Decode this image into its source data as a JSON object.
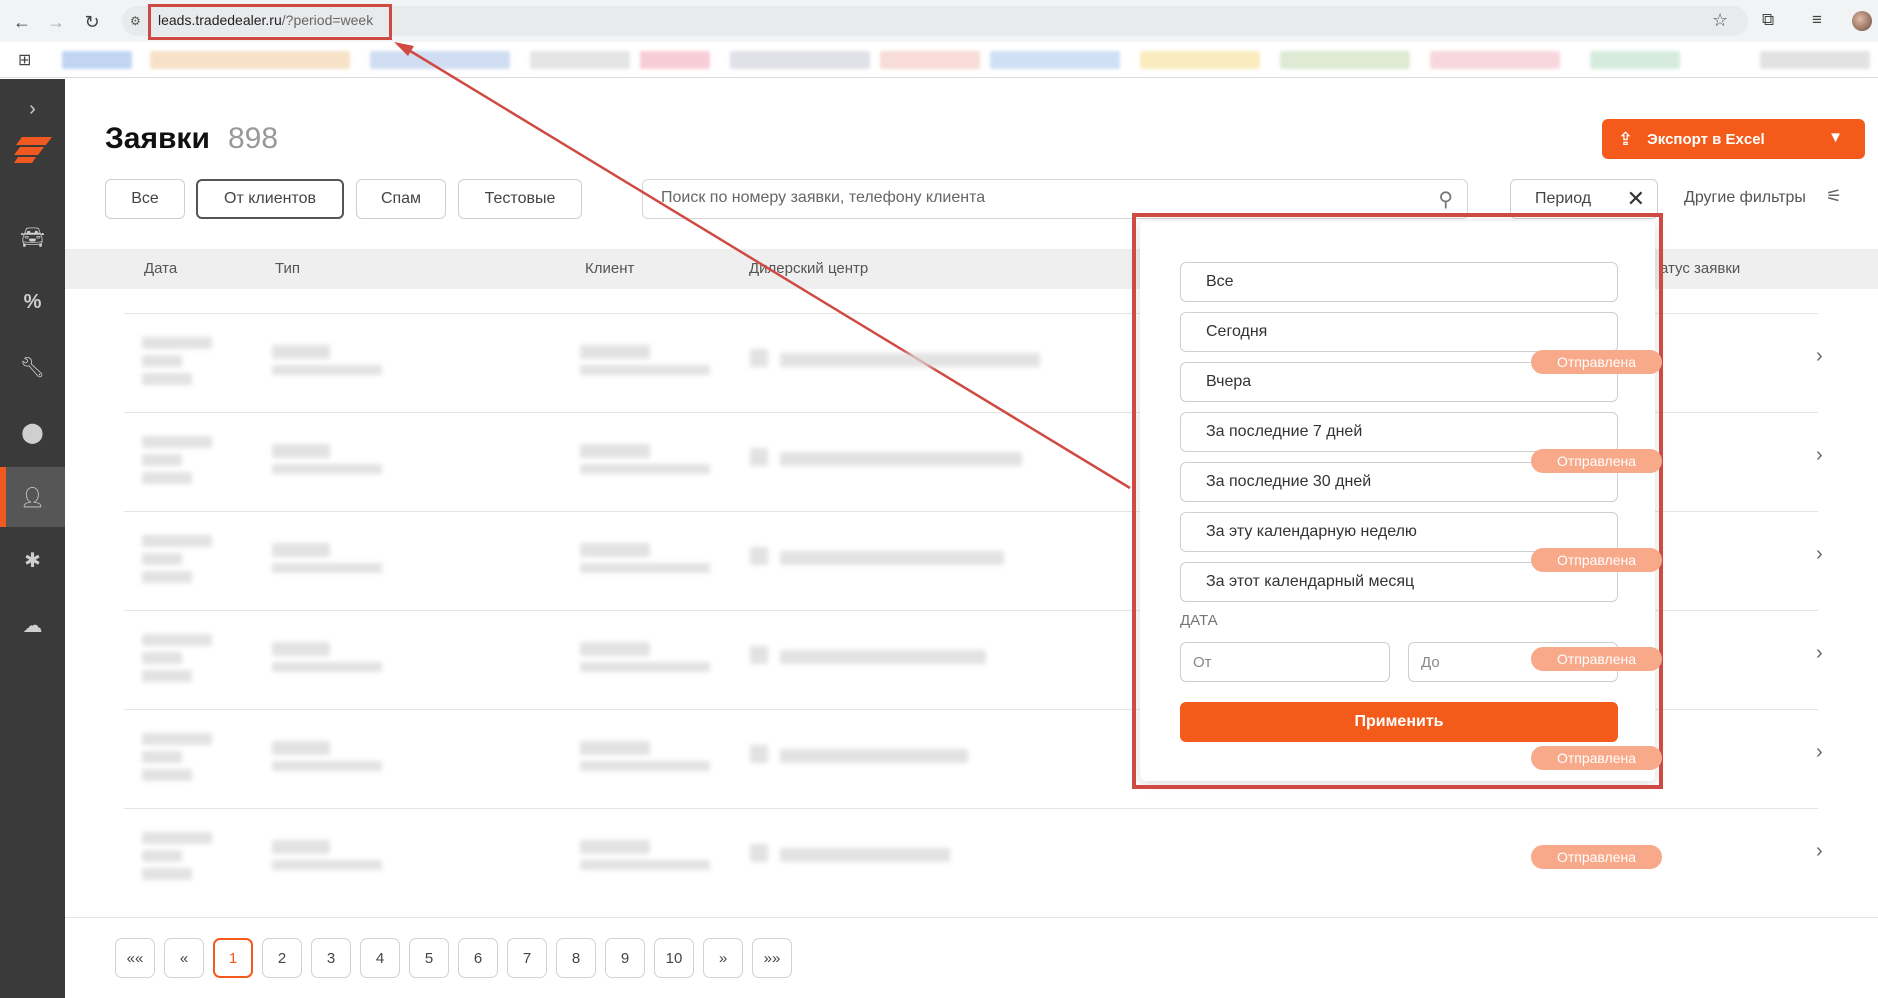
{
  "browser": {
    "url_host": "leads.tradedealer.ru",
    "url_path": "/?period=week"
  },
  "header": {
    "title": "Заявки",
    "count": "898",
    "export_label": "Экспорт в Excel"
  },
  "filters": {
    "tabs": [
      "Все",
      "От клиентов",
      "Спам",
      "Тестовые"
    ],
    "active_tab": "От клиентов",
    "search_placeholder": "Поиск по номеру заявки, телефону клиента",
    "period_label": "Период",
    "other_filters_label": "Другие фильтры"
  },
  "table": {
    "columns": [
      "Дата",
      "Тип",
      "Клиент",
      "Дилерский центр",
      "Статус заявки"
    ],
    "status_header_visible": "атус заявки",
    "rows": [
      {
        "status": "Отправлена"
      },
      {
        "status": "Отправлена"
      },
      {
        "status": "Отправлена"
      },
      {
        "status": "Отправлена"
      },
      {
        "status": "Отправлена"
      },
      {
        "status": "Отправлена"
      }
    ]
  },
  "pagination": {
    "first": "««",
    "prev": "«",
    "pages": [
      "1",
      "2",
      "3",
      "4",
      "5",
      "6",
      "7",
      "8",
      "9",
      "10"
    ],
    "current": "1",
    "next": "»",
    "last": "»»"
  },
  "period_dropdown": {
    "options": [
      "Все",
      "Сегодня",
      "Вчера",
      "За последние 7 дней",
      "За последние 30 дней",
      "За эту календарную неделю",
      "За этот календарный месяц"
    ],
    "date_label": "ДАТА",
    "from_placeholder": "От",
    "to_placeholder": "До",
    "apply_label": "Применить"
  },
  "icons": {
    "sidebar": [
      "chevron-right-icon",
      "logo-icon",
      "car-icon",
      "percent-icon",
      "wrench-icon",
      "location-pin-icon",
      "user-icon",
      "bug-icon",
      "cloud-icon"
    ]
  },
  "colors": {
    "accent": "#f45b1b",
    "status_badge": "#f7a98a",
    "annotation": "#cf4a42",
    "sidebar_bg": "#3a3a3a"
  }
}
